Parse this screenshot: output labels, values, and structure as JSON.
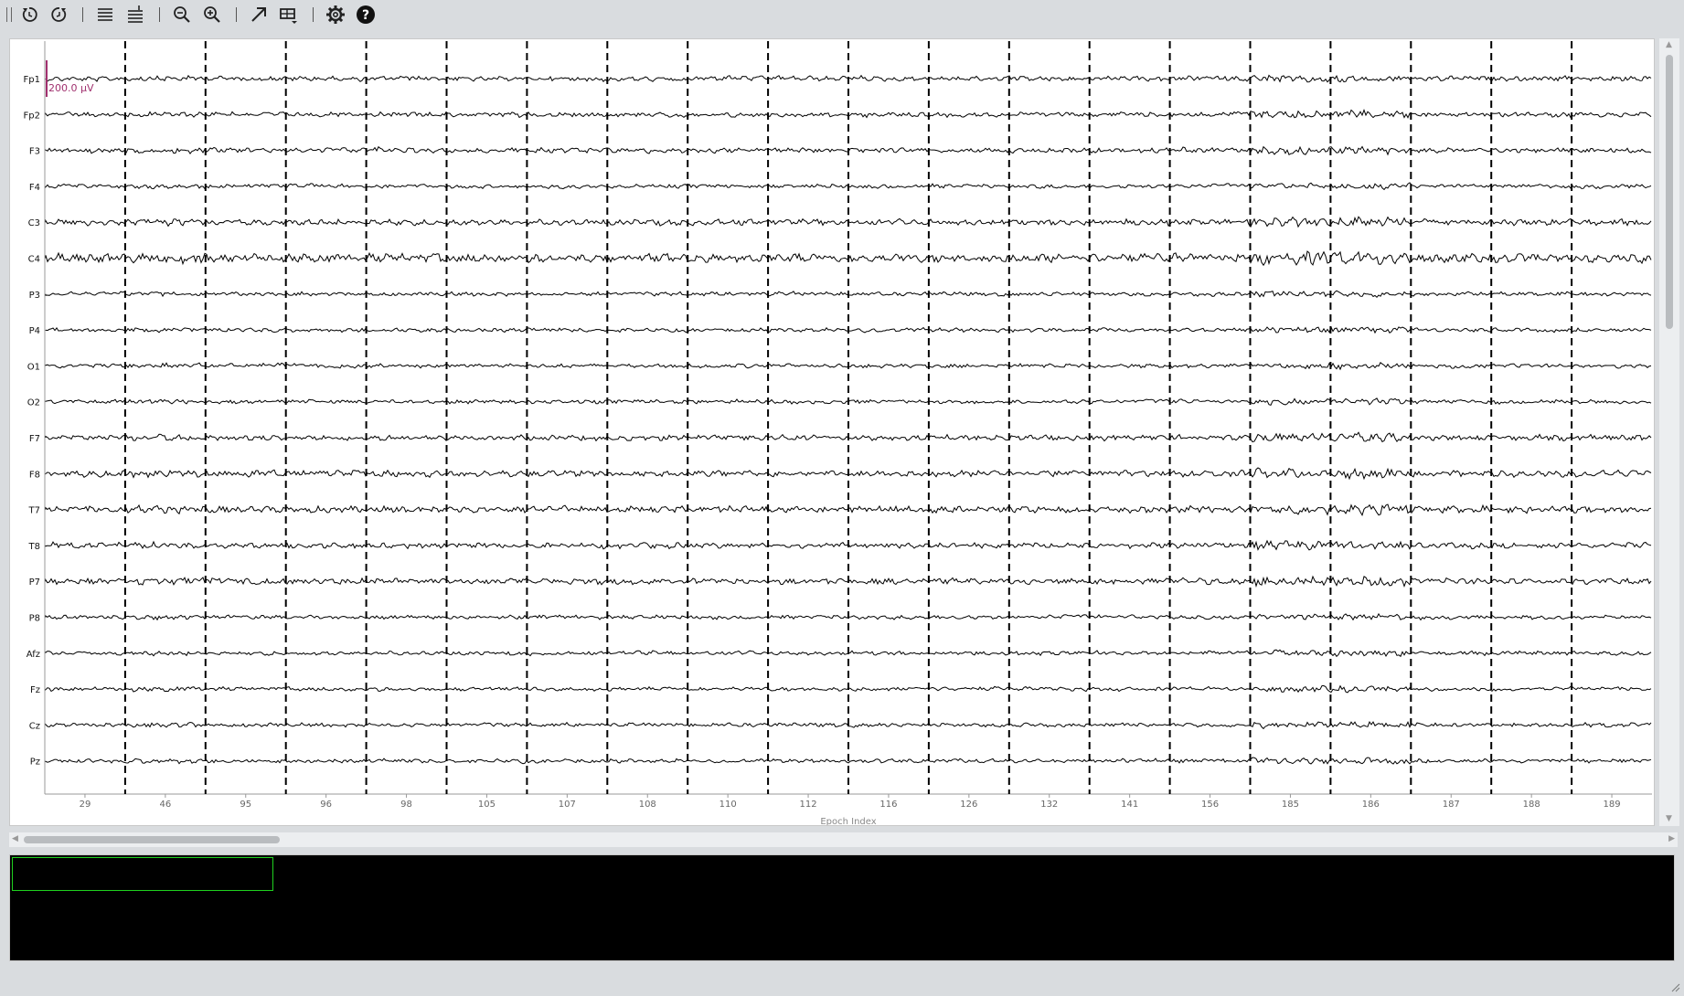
{
  "toolbar": {
    "buttons": [
      {
        "name": "history-back-button",
        "icon": "rotate-back-icon"
      },
      {
        "name": "history-forward-button",
        "icon": "rotate-forward-icon"
      },
      {
        "name": "decrease-channels-button",
        "icon": "lines-icon"
      },
      {
        "name": "increase-channels-button",
        "icon": "lines-plus-icon"
      },
      {
        "name": "zoom-out-button",
        "icon": "zoom-out-icon"
      },
      {
        "name": "zoom-in-button",
        "icon": "zoom-in-icon"
      },
      {
        "name": "jump-button",
        "icon": "arrow-up-right-icon"
      },
      {
        "name": "projection-menu-button",
        "icon": "table-dropdown-icon"
      },
      {
        "name": "settings-button",
        "icon": "gear-icon"
      },
      {
        "name": "help-button",
        "icon": "help-icon"
      }
    ]
  },
  "plot": {
    "scale_label": "200.0 µV",
    "scale_color": "#a0306e",
    "xlabel": "Epoch Index",
    "channels": [
      "Fp1",
      "Fp2",
      "F3",
      "F4",
      "C3",
      "C4",
      "P3",
      "P4",
      "O1",
      "O2",
      "F7",
      "F8",
      "T7",
      "T8",
      "P7",
      "P8",
      "Afz",
      "Fz",
      "Cz",
      "Pz"
    ],
    "epochs": [
      "29",
      "46",
      "95",
      "96",
      "98",
      "105",
      "107",
      "108",
      "110",
      "112",
      "116",
      "126",
      "132",
      "141",
      "156",
      "185",
      "186",
      "187",
      "188",
      "189"
    ]
  },
  "colors": {
    "toolbar_bg": "#d9dcdf",
    "plot_bg": "#ffffff",
    "trace": "#000000",
    "overview_bg": "#000000",
    "overview_window": "#1fd11f"
  }
}
